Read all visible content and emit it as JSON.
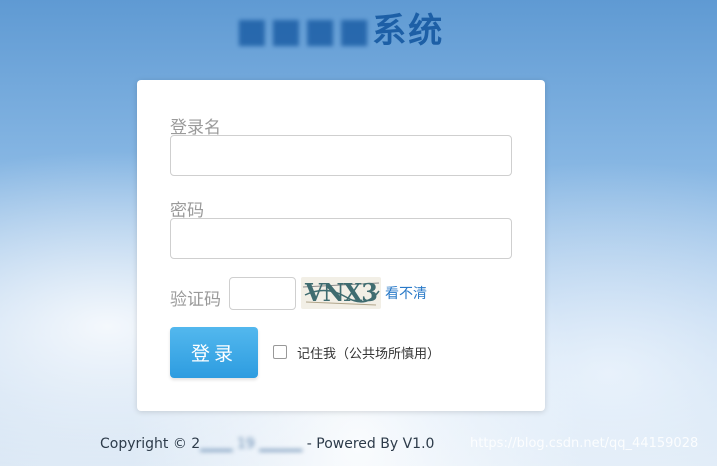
{
  "header": {
    "title_prefix_redacted": "■■■■",
    "title_suffix": "系统"
  },
  "form": {
    "username_label": "登录名",
    "username_value": "",
    "password_label": "密码",
    "password_value": "",
    "captcha_label": "验证码",
    "captcha_value": "",
    "captcha_image_text": "VNX3",
    "refresh_link": "看不清",
    "login_button": "登录",
    "remember_label": "记住我（公共场所慎用）",
    "remember_checked": false
  },
  "footer": {
    "copyright_prefix": "Copyright © 2",
    "copyright_redacted": "▁▁▁ 19 ▁▁▁▁",
    "powered_text": "- Powered By",
    "version": "V1.0"
  },
  "watermark": {
    "text": "https://blog.csdn.net/qq_44159028"
  }
}
